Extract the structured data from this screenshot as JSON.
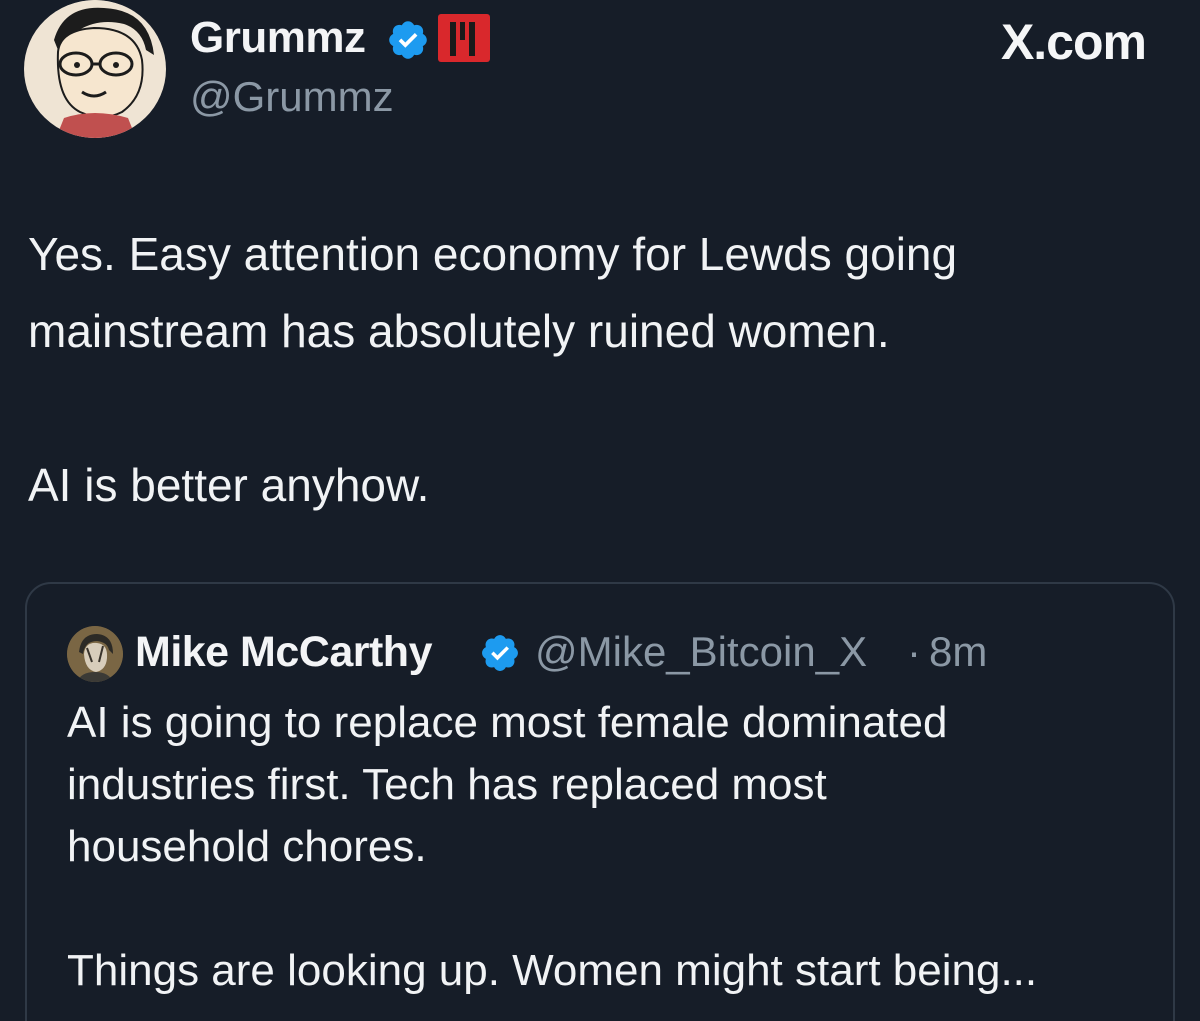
{
  "author": {
    "display_name": "Grummz",
    "handle": "@Grummz",
    "avatar": "cartoon-face-with-glasses",
    "verified_color": "#1d9bf0",
    "affiliate_badge_color": "#d9282c"
  },
  "source_label": "X.com",
  "tweet": {
    "paragraph_1_line_1": "Yes. Easy attention economy for Lewds going",
    "paragraph_1_line_2": "mainstream has absolutely ruined women.",
    "paragraph_2": "AI is better anyhow."
  },
  "quoted_tweet": {
    "display_name": "Mike McCarthy",
    "handle": "@Mike_Bitcoin_X",
    "separator": "·",
    "time": "8m",
    "line_1": "AI is going to replace most female dominated",
    "line_2": "industries first. Tech has replaced most",
    "line_3": "household chores.",
    "line_4": "Things are looking up. Women might start being..."
  },
  "colors": {
    "background": "#161d28",
    "text": "#f1f3f5",
    "secondary_text": "#8b98a5",
    "card_border": "#2f3946"
  }
}
